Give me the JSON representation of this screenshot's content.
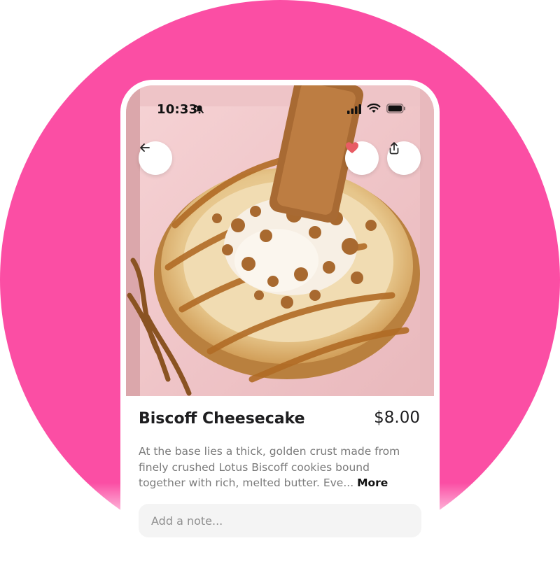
{
  "status_bar": {
    "time": "10:33"
  },
  "icons": {
    "back": "arrow-left-icon",
    "favorite": "heart-icon",
    "share": "share-upload-icon",
    "notifications_muted": "bell-slash-icon",
    "signal": "cellular-signal-icon",
    "wifi": "wifi-icon",
    "battery": "battery-icon"
  },
  "product": {
    "name": "Biscoff Cheesecake",
    "price": "$8.00",
    "description": "At the base lies a thick, golden crust made from finely crushed Lotus Biscoff cookies bound together with rich, melted butter. Eve...",
    "more_label": "More"
  },
  "note": {
    "placeholder": "Add a note..."
  },
  "colors": {
    "background_circle": "#fb4ea4",
    "favorite_heart": "#e85c64",
    "text_primary": "#1d1d1f",
    "text_secondary": "#7a7a7a"
  }
}
